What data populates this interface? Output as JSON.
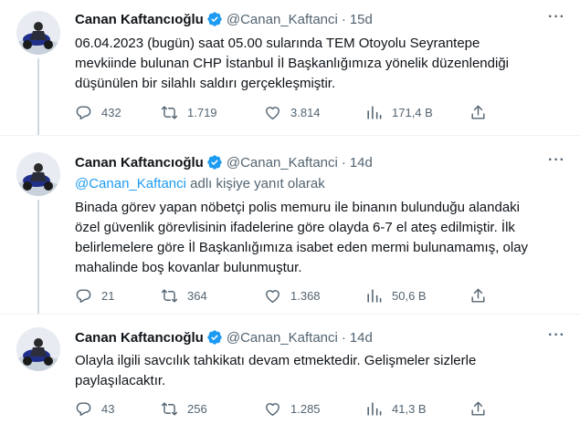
{
  "tweets": [
    {
      "name": "Canan Kaftancıoğlu",
      "handle": "@Canan_Kaftanci",
      "dot": "·",
      "time": "15d",
      "lines": [
        "06.04.2023 (bugün) saat 05.00 sularında TEM Otoyolu Seyrantepe",
        "mevkiinde bulunan CHP İstanbul İl Başkanlığımıza yönelik düzenlendiği",
        "düşünülen bir silahlı saldırı gerçekleşmiştir."
      ],
      "replies": "432",
      "retweets": "1.719",
      "likes": "3.814",
      "views": "171,4 B"
    },
    {
      "name": "Canan Kaftancıoğlu",
      "handle": "@Canan_Kaftanci",
      "dot": "·",
      "time": "14d",
      "reply_to_mention": "@Canan_Kaftanci",
      "reply_to_suffix": " adlı kişiye yanıt olarak",
      "lines": [
        "Binada görev yapan nöbetçi polis memuru ile binanın bulunduğu alandaki",
        "özel güvenlik görevlisinin ifadelerine göre olayda 6-7 el ateş edilmiştir. İlk",
        "belirlemelere göre İl Başkanlığımıza isabet eden mermi bulunamamış, olay",
        "mahalinde boş kovanlar bulunmuştur."
      ],
      "replies": "21",
      "retweets": "364",
      "likes": "1.368",
      "views": "50,6 B"
    },
    {
      "name": "Canan Kaftancıoğlu",
      "handle": "@Canan_Kaftanci",
      "dot": "·",
      "time": "14d",
      "lines": [
        "Olayla ilgili savcılık tahkikatı devam etmektedir. Gelişmeler sizlerle",
        "paylaşılacaktır."
      ],
      "replies": "43",
      "retweets": "256",
      "likes": "1.285",
      "views": "41,3 B"
    }
  ],
  "icons": {
    "more": "more-horizontal-icon",
    "verified": "verified-badge-icon",
    "reply": "reply-icon",
    "retweet": "retweet-icon",
    "like": "heart-icon",
    "views": "views-chart-icon",
    "share": "share-icon"
  },
  "colors": {
    "verified": "#1d9bf0",
    "mention": "#1d9bf0",
    "secondary_text": "#536471",
    "thread_line": "#cfd9de"
  }
}
